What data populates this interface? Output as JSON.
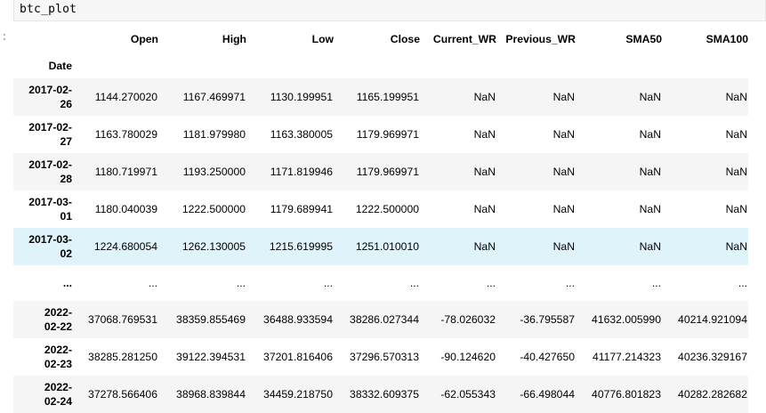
{
  "input": {
    "code": "btc_plot"
  },
  "table": {
    "columns": [
      "Open",
      "High",
      "Low",
      "Close",
      "Current_WR",
      "Previous_WR",
      "SMA50",
      "SMA100"
    ],
    "index_name": "Date",
    "rows": [
      {
        "date_a": "2017-02-",
        "date_b": "26",
        "values": [
          "1144.270020",
          "1167.469971",
          "1130.199951",
          "1165.199951",
          "NaN",
          "NaN",
          "NaN",
          "NaN"
        ]
      },
      {
        "date_a": "2017-02-",
        "date_b": "27",
        "values": [
          "1163.780029",
          "1181.979980",
          "1163.380005",
          "1179.969971",
          "NaN",
          "NaN",
          "NaN",
          "NaN"
        ]
      },
      {
        "date_a": "2017-02-",
        "date_b": "28",
        "values": [
          "1180.719971",
          "1193.250000",
          "1171.819946",
          "1179.969971",
          "NaN",
          "NaN",
          "NaN",
          "NaN"
        ]
      },
      {
        "date_a": "2017-03-",
        "date_b": "01",
        "values": [
          "1180.040039",
          "1222.500000",
          "1179.689941",
          "1222.500000",
          "NaN",
          "NaN",
          "NaN",
          "NaN"
        ]
      },
      {
        "date_a": "2017-03-",
        "date_b": "02",
        "values": [
          "1224.680054",
          "1262.130005",
          "1215.619995",
          "1251.010010",
          "NaN",
          "NaN",
          "NaN",
          "NaN"
        ]
      },
      {
        "date_a": "...",
        "date_b": "",
        "values": [
          "...",
          "...",
          "...",
          "...",
          "...",
          "...",
          "...",
          "..."
        ]
      },
      {
        "date_a": "2022-",
        "date_b": "02-22",
        "values": [
          "37068.769531",
          "38359.855469",
          "36488.933594",
          "38286.027344",
          "-78.026032",
          "-36.795587",
          "41632.005990",
          "40214.921094"
        ]
      },
      {
        "date_a": "2022-",
        "date_b": "02-23",
        "values": [
          "38285.281250",
          "39122.394531",
          "37201.816406",
          "37296.570313",
          "-90.124620",
          "-40.427650",
          "41177.214323",
          "40236.329167"
        ]
      },
      {
        "date_a": "2022-",
        "date_b": "02-24",
        "values": [
          "37278.566406",
          "38968.839844",
          "34459.218750",
          "38332.609375",
          "-62.055343",
          "-66.498044",
          "40776.801823",
          "40282.282682"
        ]
      }
    ]
  }
}
